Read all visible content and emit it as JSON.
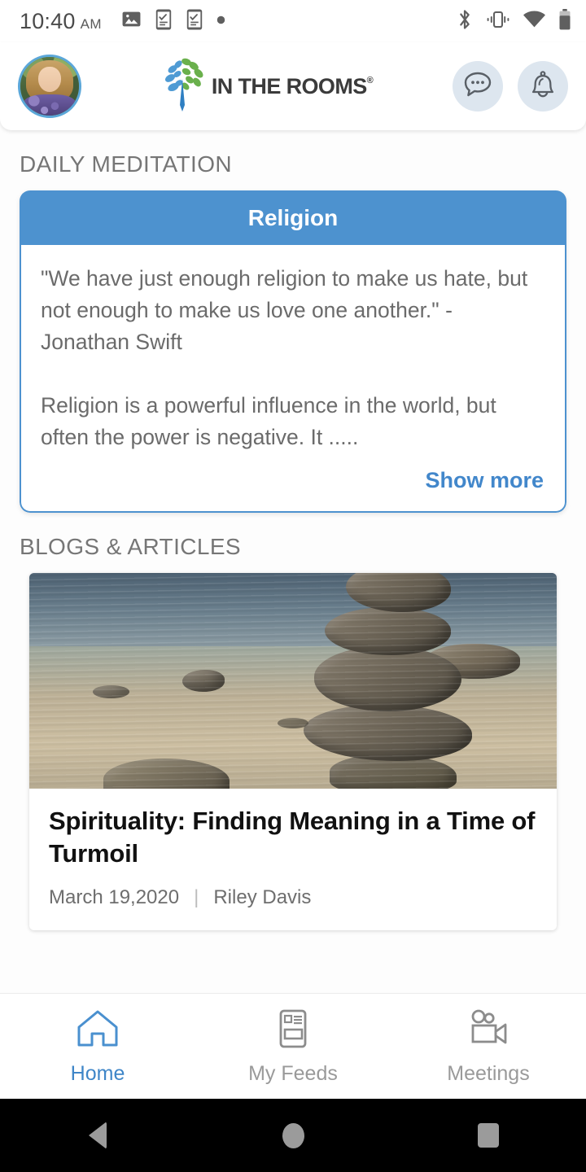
{
  "status_bar": {
    "time": "10:40",
    "ampm": "AM",
    "left_icons": [
      "image-icon",
      "phone-check-icon",
      "phone-check-icon",
      "dot-icon"
    ],
    "right_icons": [
      "bluetooth-icon",
      "vibrate-icon",
      "wifi-icon",
      "battery-icon"
    ]
  },
  "header": {
    "avatar_alt": "user-avatar",
    "logo_text": "IN THE ROOMS",
    "logo_trademark": "®",
    "chat_icon": "chat-bubble-icon",
    "notification_icon": "bell-icon"
  },
  "sections": {
    "meditation_title": "DAILY MEDITATION",
    "blogs_title": "BLOGS & ARTICLES"
  },
  "meditation_card": {
    "category": "Religion",
    "quote": "\"We have just enough religion to make us hate, but not enough to make us love one another.\" - Jonathan Swift",
    "body": "Religion is a powerful influence in the world, but often the power is negative. It .....",
    "show_more": "Show more",
    "accent_color": "#4d92cf",
    "link_color": "#4287cb"
  },
  "blog_card": {
    "image_alt": "stacked-stones-in-lake-photo",
    "title": "Spirituality: Finding Meaning in a Time of Turmoil",
    "date": "March 19,2020",
    "separator": "|",
    "author": "Riley Davis"
  },
  "bottom_nav": {
    "items": [
      {
        "label": "Home",
        "icon": "home-icon",
        "active": true
      },
      {
        "label": "My Feeds",
        "icon": "newspaper-icon",
        "active": false
      },
      {
        "label": "Meetings",
        "icon": "video-camera-icon",
        "active": false
      }
    ],
    "active_color": "#3f86c8",
    "inactive_color": "#9a9a9a"
  },
  "system_nav": {
    "back": "back-triangle",
    "home": "home-circle",
    "recents": "recents-square"
  }
}
